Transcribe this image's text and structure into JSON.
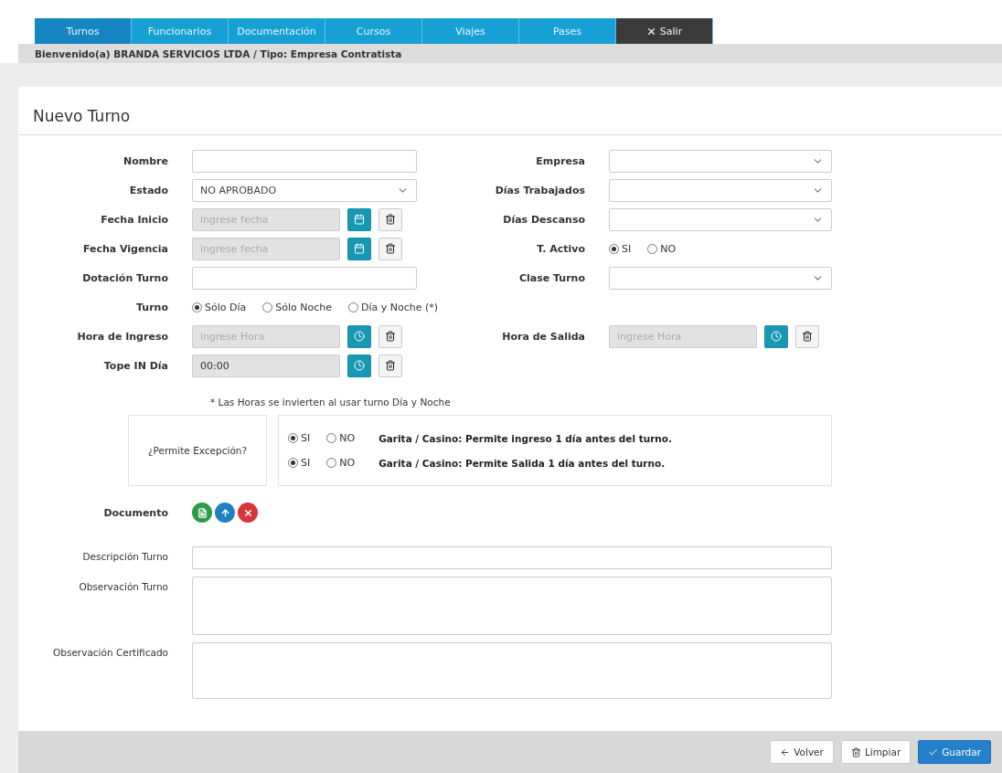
{
  "nav": {
    "tabs": [
      {
        "label": "Turnos",
        "selected": true,
        "kind": "tab"
      },
      {
        "label": "Funcionarios",
        "selected": false,
        "kind": "tab"
      },
      {
        "label": "Documentación",
        "selected": false,
        "kind": "tab"
      },
      {
        "label": "Cursos",
        "selected": false,
        "kind": "tab"
      },
      {
        "label": "Viajes",
        "selected": false,
        "kind": "tab"
      },
      {
        "label": "Pases",
        "selected": false,
        "kind": "tab"
      },
      {
        "label": "Salir",
        "selected": false,
        "kind": "exit"
      }
    ]
  },
  "welcome": "Bienvenido(a) BRANDA SERVICIOS LTDA / Tipo: Empresa Contratista",
  "title": "Nuevo Turno",
  "rows": [
    {
      "cells": [
        {
          "label": "Nombre",
          "kind": "text"
        },
        {
          "label": "Empresa",
          "kind": "select"
        }
      ]
    },
    {
      "cells": [
        {
          "label": "Estado",
          "kind": "select",
          "value": "NO APROBADO"
        },
        {
          "label": "Días Trabajados",
          "kind": "select"
        }
      ]
    },
    {
      "cells": [
        {
          "label": "Fecha Inicio",
          "kind": "date",
          "placeholder": "ingrese fecha"
        },
        {
          "label": "Días Descanso",
          "kind": "select"
        }
      ]
    },
    {
      "cells": [
        {
          "label": "Fecha Vigencia",
          "kind": "date",
          "placeholder": "ingrese fecha"
        },
        {
          "label": "T. Activo",
          "kind": "radio",
          "options": [
            {
              "label": "SI",
              "selected": true
            },
            {
              "label": "NO",
              "selected": false
            }
          ]
        }
      ]
    },
    {
      "cells": [
        {
          "label": "Dotación Turno",
          "kind": "text"
        },
        {
          "label": "Clase Turno",
          "kind": "select"
        }
      ]
    },
    {
      "cells": [
        {
          "label": "Turno",
          "kind": "radio",
          "options": [
            {
              "label": "Sólo Día",
              "selected": true
            },
            {
              "label": "Sólo Noche",
              "selected": false
            },
            {
              "label": "Día y Noche (*)",
              "selected": false
            }
          ]
        }
      ]
    },
    {
      "cells": [
        {
          "label": "Hora de Ingreso",
          "kind": "time",
          "placeholder": "ingrese Hora"
        },
        {
          "label": "Hora de Salida",
          "kind": "time",
          "placeholder": "ingrese Hora"
        }
      ]
    },
    {
      "cells": [
        {
          "label": "Tope IN Día",
          "kind": "time",
          "value": "00:00"
        }
      ]
    }
  ],
  "note": "* Las Horas se invierten al usar turno Día y Noche",
  "exception": {
    "label": "¿Permite Excepción?",
    "rows": [
      {
        "options": [
          {
            "label": "SI",
            "selected": true
          },
          {
            "label": "NO",
            "selected": false
          }
        ],
        "text": "Garita / Casino: Permite ingreso 1 día antes del turno."
      },
      {
        "options": [
          {
            "label": "SI",
            "selected": true
          },
          {
            "label": "NO",
            "selected": false
          }
        ],
        "text": "Garita / Casino: Permite Salida 1 día antes del turno."
      }
    ]
  },
  "document": {
    "label": "Documento",
    "buttons": [
      {
        "kind": "file",
        "color": "#2e9b48"
      },
      {
        "kind": "upload",
        "color": "#1f80c0"
      },
      {
        "kind": "delete",
        "color": "#d8353a"
      }
    ]
  },
  "text_fields": [
    {
      "label": "Descripción Turno",
      "kind": "line"
    },
    {
      "label": "Observación Turno",
      "kind": "area"
    },
    {
      "label": "Observación Certificado",
      "kind": "area"
    }
  ],
  "footer": {
    "buttons": [
      {
        "label": "Volver",
        "kind": "back"
      },
      {
        "label": "Limpiar",
        "kind": "clear"
      },
      {
        "label": "Guardar",
        "kind": "save"
      }
    ]
  }
}
